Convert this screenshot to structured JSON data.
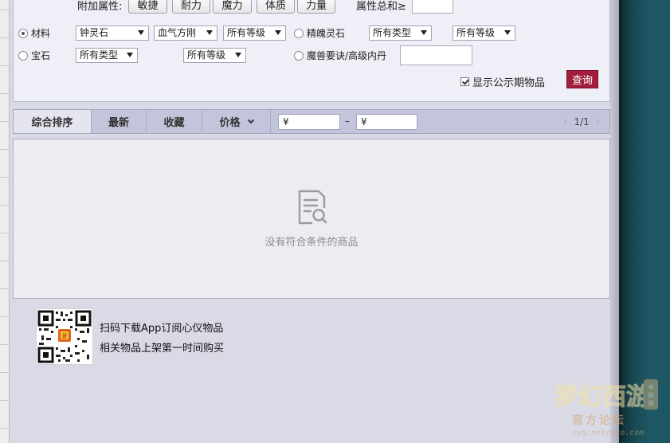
{
  "attributes": {
    "label": "附加属性:",
    "buttons": [
      "敏捷",
      "耐力",
      "魔力",
      "体质",
      "力量"
    ],
    "sum_label": "属性总和≥",
    "sum_value": ""
  },
  "material_row": {
    "radio_label": "材料",
    "selected": true,
    "select1": "钟灵石",
    "select2": "血气方刚",
    "select3": "所有等级"
  },
  "spirit_row": {
    "radio_label": "精魄灵石",
    "select1": "所有类型",
    "select2": "所有等级"
  },
  "gem_row": {
    "radio_label": "宝石",
    "select1": "所有类型",
    "select2": "所有等级"
  },
  "beast_row": {
    "radio_label": "魔兽要诀/高级内丹",
    "input_value": ""
  },
  "show_public": {
    "label": "显示公示期物品",
    "checked": true
  },
  "query_button": "查询",
  "sort_bar": {
    "tabs": [
      "综合排序",
      "最新",
      "收藏",
      "价格"
    ],
    "active": "综合排序",
    "price_min": "¥",
    "price_max": "¥",
    "separator": "–",
    "page_indicator": "1/1"
  },
  "results": {
    "empty_message": "没有符合条件的商品"
  },
  "qr_section": {
    "line1": "扫码下载App订阅心仪物品",
    "line2": "相关物品上架第一时间购买"
  },
  "watermark": {
    "title": "梦幻西游",
    "subtitle": "官方论坛",
    "url": "xyq.netease.com",
    "badge": "电脑版"
  },
  "icons": {
    "empty": "document-search-icon",
    "page_prev": "chevron-left-icon",
    "page_next": "chevron-right-icon",
    "sort_dropdown": "chevron-down-icon"
  },
  "colors": {
    "accent": "#a21e3c",
    "background": "#d9dae5",
    "panel": "#eeeff7",
    "sort_bar": "#c3c5dc",
    "right_bg": "#1d5562"
  }
}
